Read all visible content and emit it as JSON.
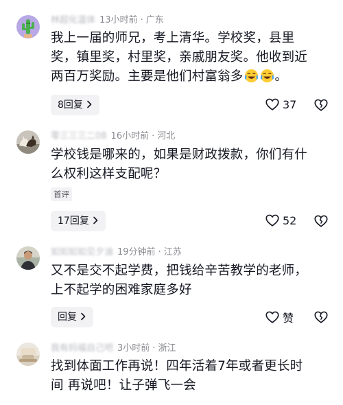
{
  "comments": [
    {
      "username": "林超化温体",
      "time": "13小时前",
      "location": "广东",
      "line1": "我上一届的师兄，考上清华。学校奖，县里",
      "line2": "奖，镇里奖，村里奖，亲戚朋友奖。他收到近",
      "line3_prefix": "两百万奖励。主要是他们村富翁多",
      "line3_suffix": "。",
      "reply_label": "8回复",
      "like_count": "37"
    },
    {
      "username": "零三三三二08",
      "time": "16小时前",
      "location": "河北",
      "line1": "学校钱是哪来的，如果是财政拨款，你们有什",
      "line2": "么权利这样支配呢？",
      "tag": "首评",
      "reply_label": "17回复",
      "like_count": "52"
    },
    {
      "username": "如如如如见夕油",
      "time": "19分钟前",
      "location": "江苏",
      "line1": "又不是交不起学费，把钱给辛苦教学的老师，",
      "line2": "上不起学的困难家庭多好",
      "reply_label": "回复",
      "like_count": "赞"
    },
    {
      "username": "我有妈福自己吧",
      "time": "3小时前",
      "location": "浙江",
      "line1": "找到体面工作再说！四年活着7年或者更长时",
      "line2": "间 再说吧！让子弹飞一会"
    }
  ],
  "icons": {
    "heart": "heart-outline-icon",
    "dislike": "broken-heart-icon",
    "chevron": "chevron-right-icon",
    "emoji": "crying-laughing-emoji"
  }
}
